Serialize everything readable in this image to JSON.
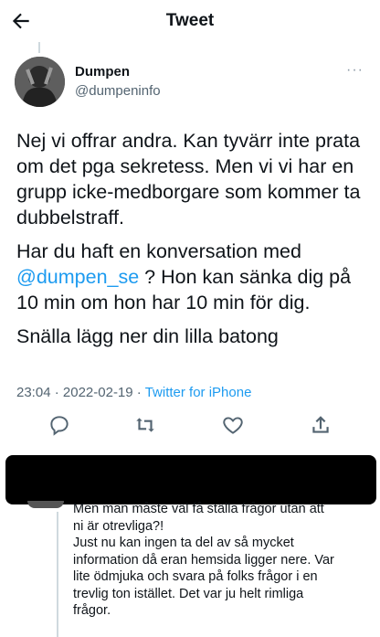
{
  "header": {
    "title": "Tweet",
    "back_icon": "arrow-left-icon"
  },
  "author": {
    "display_name": "Dumpen",
    "handle": "@dumpeninfo",
    "more_label": "···"
  },
  "tweet": {
    "paragraph1": "Nej vi offrar andra. Kan tyvärr inte prata om det pga sekretess. Men vi vi har en grupp icke-medborgare som kommer ta dubbelstraff.",
    "paragraph2_before": "Har du haft en konversation med ",
    "paragraph2_mention": "@dumpen_se",
    "paragraph2_after": " ? Hon kan sänka dig på 10 min om hon har 10 min för dig.",
    "paragraph3": "Snälla lägg ner din lilla batong",
    "time": "23:04",
    "date": "2022-02-19",
    "separator": " · ",
    "source": "Twitter for iPhone"
  },
  "actions": {
    "reply_icon": "reply-icon",
    "retweet_icon": "retweet-icon",
    "like_icon": "heart-icon",
    "share_icon": "share-icon"
  },
  "reply": {
    "text": "Men man måste väl få ställa frågor utan att\nni är otrevliga?!\nJust nu kan ingen ta del av så mycket\ninformation då eran hemsida ligger nere. Var\nlite ödmjuka och svara på folks frågor i en\ntrevlig ton istället. Det var ju helt rimliga\nfrågor."
  },
  "colors": {
    "accent": "#1d9bf0",
    "secondary_text": "#536471",
    "primary_text": "#0f1419"
  }
}
